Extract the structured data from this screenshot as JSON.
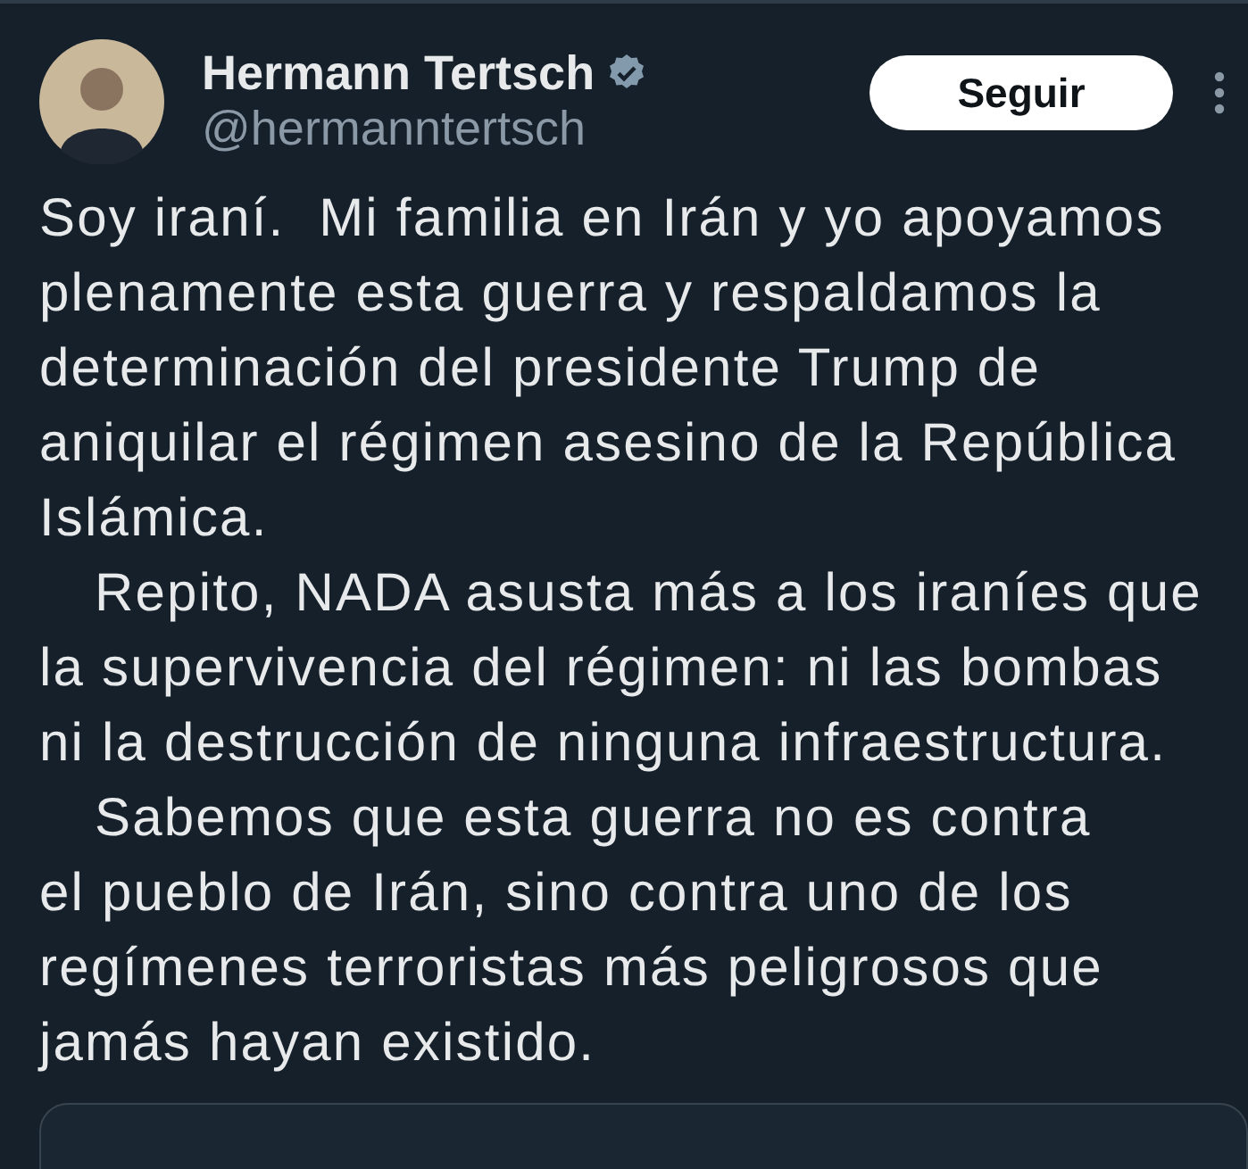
{
  "author": {
    "name": "Hermann Tertsch",
    "verified": true,
    "handle": "@hermanntertsch"
  },
  "follow_button": {
    "label": "Seguir"
  },
  "paragraphs": [
    {
      "indented": false,
      "lines": [
        "Soy iraní.  Mi familia en Irán y yo apoyamos",
        "plenamente esta guerra y respaldamos la",
        "determinación del presidente Trump de",
        "aniquilar el régimen asesino de la República",
        "Islámica."
      ]
    },
    {
      "indented": true,
      "lines": [
        "Repito, NADA asusta más a los iraníes que",
        "la supervivencia del régimen: ni las bombas",
        "ni la destrucción de ninguna infraestructura."
      ]
    },
    {
      "indented": true,
      "lines": [
        "Sabemos que esta guerra no es contra",
        "el pueblo de Irán, sino contra uno de los",
        "regímenes terroristas más peligrosos que",
        "jamás hayan existido."
      ]
    }
  ]
}
